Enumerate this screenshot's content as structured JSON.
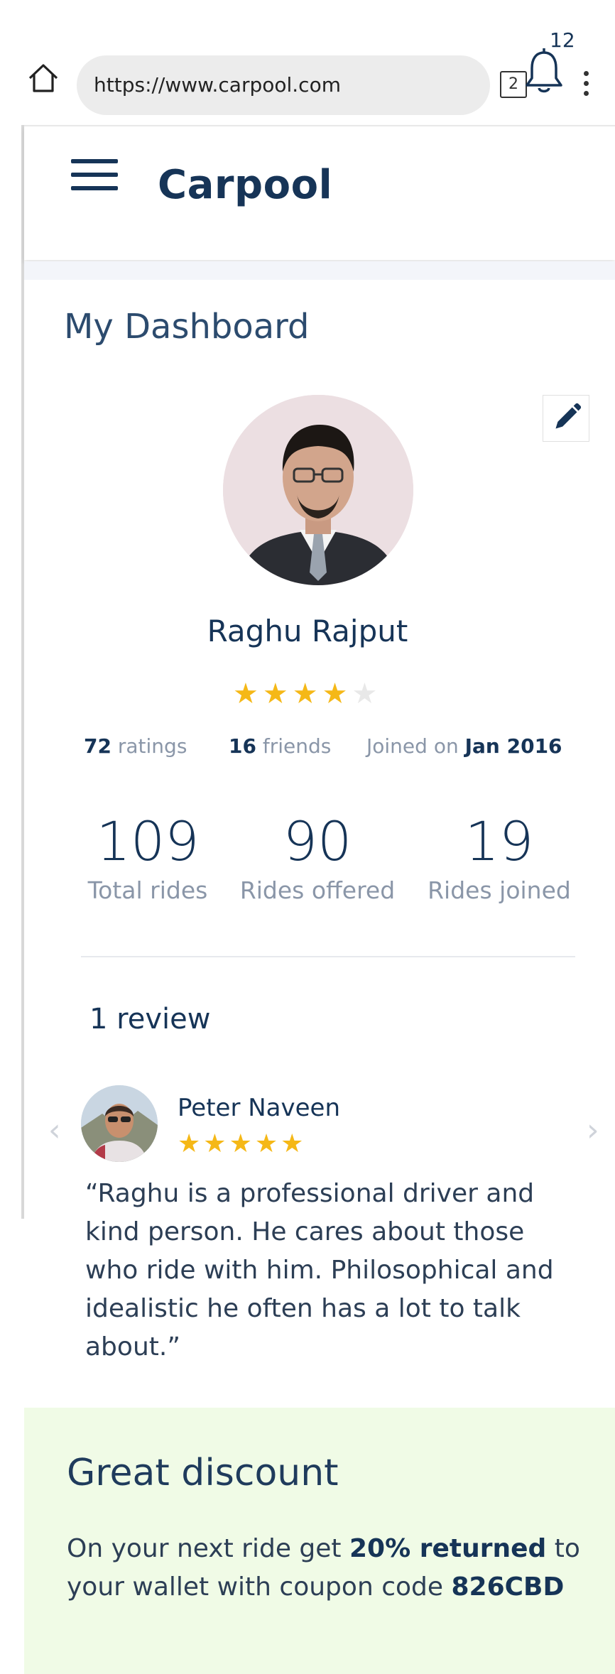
{
  "browser": {
    "url": "https://www.carpool.com",
    "tab_count": "2"
  },
  "header": {
    "app_title": "Carpool",
    "notification_count": "12"
  },
  "dashboard": {
    "title": "My Dashboard",
    "profile": {
      "name": "Raghu Rajput",
      "rating_stars": 4,
      "rating_max": 5,
      "ratings_count": "72",
      "ratings_label": "ratings",
      "friends_count": "16",
      "friends_label": "friends",
      "joined_label": "Joined on",
      "joined_date": "Jan 2016"
    },
    "stats": [
      {
        "value": "109",
        "label": "Total rides"
      },
      {
        "value": "90",
        "label": "Rides offered"
      },
      {
        "value": "19",
        "label": "Rides joined"
      }
    ],
    "reviews": {
      "count_label": "1 review",
      "items": [
        {
          "reviewer": "Peter Naveen",
          "stars": 5,
          "text": "“Raghu is a professional driver and kind person. He cares about those who ride with him. Philosophical and idealistic he often has a lot to talk about.”"
        }
      ]
    }
  },
  "discount": {
    "title": "Great discount",
    "body_prefix": "On your next ride get",
    "highlight": "20% returned",
    "body_middle": "to your wallet with coupon code",
    "coupon_code": "826CBD"
  },
  "colors": {
    "brand_navy": "#163457",
    "star_gold": "#f5b817",
    "discount_bg": "#f0fbe6"
  },
  "icons": [
    "home-icon",
    "tabs-icon",
    "more-vertical-icon",
    "menu-icon",
    "bell-icon",
    "pencil-icon",
    "chevron-left-icon",
    "chevron-right-icon",
    "star-icon"
  ]
}
